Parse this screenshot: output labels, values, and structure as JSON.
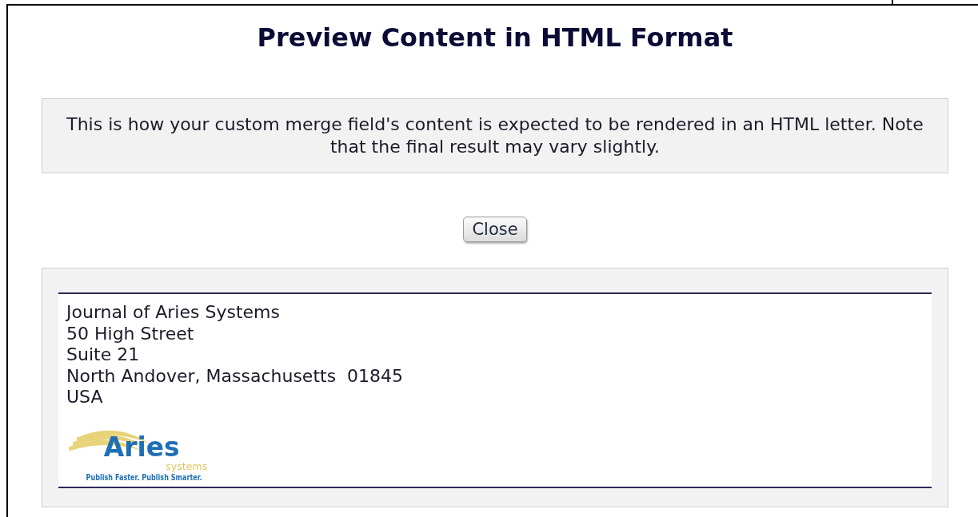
{
  "dialog": {
    "title": "Preview Content in HTML Format"
  },
  "notice": {
    "text": "This is how your custom merge field's content is expected to be rendered in an HTML letter. Note that the final result may vary slightly."
  },
  "close_button": {
    "label": "Close"
  },
  "preview": {
    "address_lines": [
      "Journal of Aries Systems",
      "50 High Street",
      "Suite 21",
      "North Andover, Massachusetts  01845",
      "USA"
    ],
    "logo": {
      "name": "Aries",
      "subname": "systems",
      "tagline": "Publish Faster. Publish Smarter."
    }
  }
}
